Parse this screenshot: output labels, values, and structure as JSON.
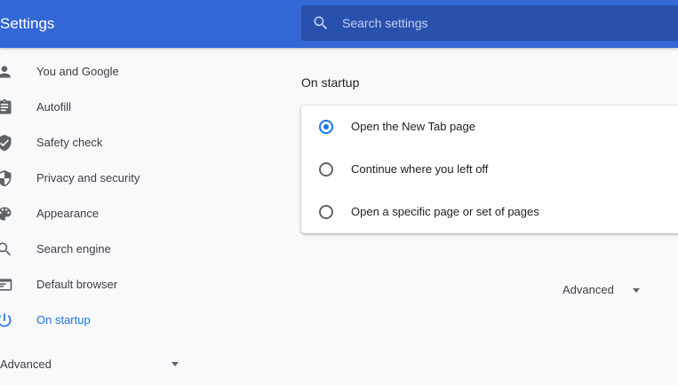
{
  "header": {
    "title": "Settings",
    "search": {
      "placeholder": "Search settings",
      "value": ""
    }
  },
  "sidebar": {
    "items": [
      {
        "label": "You and Google",
        "icon": "person-icon"
      },
      {
        "label": "Autofill",
        "icon": "clipboard-icon"
      },
      {
        "label": "Safety check",
        "icon": "shield-check-icon"
      },
      {
        "label": "Privacy and security",
        "icon": "shield-icon"
      },
      {
        "label": "Appearance",
        "icon": "palette-icon"
      },
      {
        "label": "Search engine",
        "icon": "search-icon"
      },
      {
        "label": "Default browser",
        "icon": "browser-icon"
      },
      {
        "label": "On startup",
        "icon": "power-icon",
        "active": true
      }
    ],
    "advanced_label": "Advanced"
  },
  "main": {
    "section_title": "On startup",
    "options": [
      {
        "label": "Open the New Tab page",
        "checked": true
      },
      {
        "label": "Continue where you left off",
        "checked": false
      },
      {
        "label": "Open a specific page or set of pages",
        "checked": false
      }
    ],
    "advanced_label": "Advanced"
  },
  "colors": {
    "header": "#3367d6",
    "search_box": "#2850ac",
    "accent": "#1a73e8",
    "background": "#f8f9fa"
  }
}
